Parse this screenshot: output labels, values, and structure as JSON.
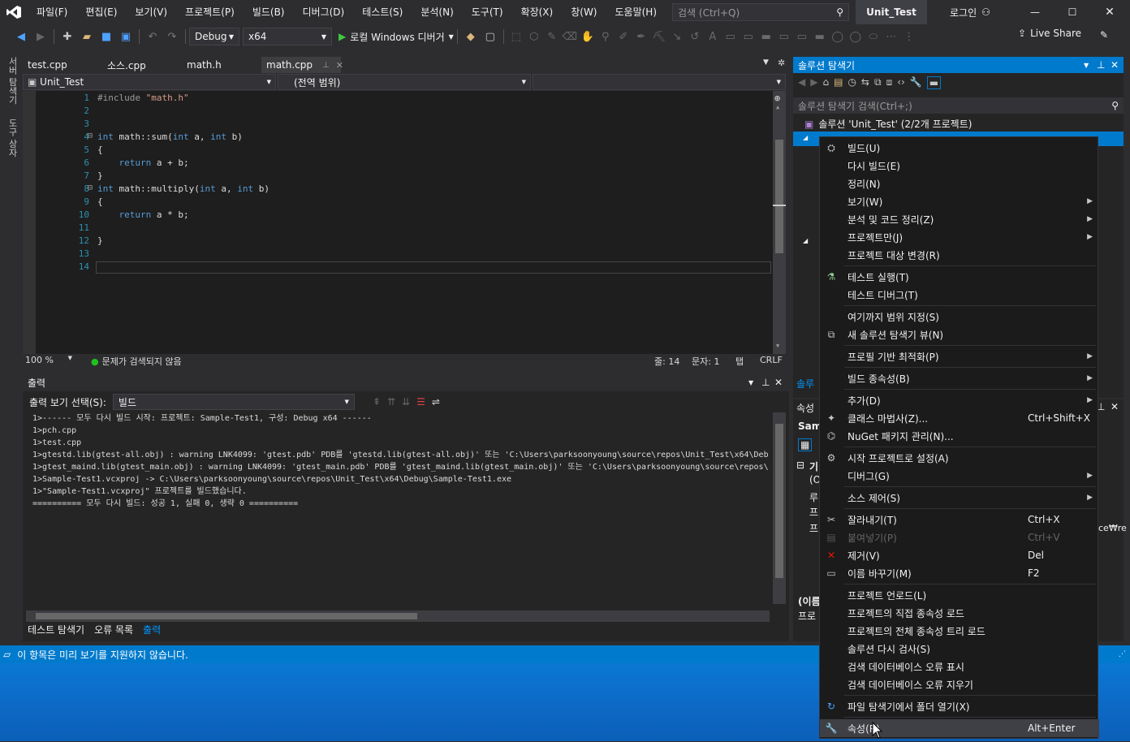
{
  "menubar": {
    "items": [
      "파일(F)",
      "편집(E)",
      "보기(V)",
      "프로젝트(P)",
      "빌드(B)",
      "디버그(D)",
      "테스트(S)",
      "분석(N)",
      "도구(T)",
      "확장(X)",
      "창(W)",
      "도움말(H)"
    ],
    "search_placeholder": "검색 (Ctrl+Q)",
    "solution_name": "Unit_Test",
    "login": "로그인"
  },
  "toolbar": {
    "config": "Debug",
    "platform": "x64",
    "run_label": "로컬 Windows 디버거",
    "live_share": "Live Share"
  },
  "left_strip": {
    "server_explorer": "서버 탐색기",
    "toolbox": "도구 상자"
  },
  "editor_tabs": [
    {
      "label": "test.cpp"
    },
    {
      "label": "소스.cpp"
    },
    {
      "label": "math.h"
    },
    {
      "label": "math.cpp",
      "active": true
    }
  ],
  "navbar": {
    "project": "Unit_Test",
    "scope": "(전역 범위)"
  },
  "code_lines": [
    {
      "n": "1",
      "text": "#include \"math.h\""
    },
    {
      "n": "2",
      "text": ""
    },
    {
      "n": "3",
      "text": ""
    },
    {
      "n": "4",
      "text": "int math::sum(int a, int b)"
    },
    {
      "n": "5",
      "text": "{"
    },
    {
      "n": "6",
      "text": "    return a + b;"
    },
    {
      "n": "7",
      "text": "}"
    },
    {
      "n": "8",
      "text": "int math::multiply(int a, int b)"
    },
    {
      "n": "9",
      "text": "{"
    },
    {
      "n": "10",
      "text": "    return a * b;"
    },
    {
      "n": "11",
      "text": ""
    },
    {
      "n": "12",
      "text": "}"
    },
    {
      "n": "13",
      "text": ""
    },
    {
      "n": "14",
      "text": ""
    }
  ],
  "editor_status": {
    "zoom": "100 %",
    "issues": "문제가 검색되지 않음",
    "line": "줄: 14",
    "col": "문자: 1",
    "tab": "탭",
    "eol": "CRLF"
  },
  "output": {
    "title": "출력",
    "source_label": "출력 보기 선택(S):",
    "source_value": "빌드",
    "lines": [
      "1>------ 모두 다시 빌드 시작: 프로젝트: Sample-Test1, 구성: Debug x64 ------",
      "1>pch.cpp",
      "1>test.cpp",
      "1>gtestd.lib(gtest-all.obj) : warning LNK4099: 'gtest.pdb' PDB를 'gtestd.lib(gtest-all.obj)' 또는 'C:\\Users\\parksoonyoung\\source\\repos\\Unit_Test\\x64\\Deb",
      "1>gtest_maind.lib(gtest_main.obj) : warning LNK4099: 'gtest_main.pdb' PDB를 'gtest_maind.lib(gtest_main.obj)' 또는 'C:\\Users\\parksoonyoung\\source\\repos\\",
      "1>Sample-Test1.vcxproj -> C:\\Users\\parksoonyoung\\source\\repos\\Unit_Test\\x64\\Debug\\Sample-Test1.exe",
      "1>\"Sample-Test1.vcxproj\" 프로젝트를 빌드했습니다.",
      "========== 모두 다시 빌드: 성공 1, 실패 0, 생략 0 =========="
    ]
  },
  "bottom_tabs": [
    "테스트 탐색기",
    "오류 목록",
    "출력"
  ],
  "statusbar": {
    "message": "이 항목은 미리 보기를 지원하지 않습니다."
  },
  "solution_explorer": {
    "title": "솔루션 탐색기",
    "search_placeholder": "솔루션 탐색기 검색(Ctrl+;)",
    "root": "솔루션 'Unit_Test' (2/2개 프로젝트)",
    "lower_tab": "솔루",
    "props_title": "속성",
    "props_sam": "Sam",
    "props_gi": "기",
    "props_o": "(O",
    "props_ru": "루",
    "props_p1": "프",
    "props_p2": "프",
    "props_name": "(이름",
    "props_p3": "프로",
    "props_path_tail": "ce₩re"
  },
  "context_menu": {
    "items": [
      {
        "label": "빌드(U)",
        "icon": "build-icon"
      },
      {
        "label": "다시 빌드(E)"
      },
      {
        "label": "정리(N)"
      },
      {
        "label": "보기(W)",
        "submenu": true
      },
      {
        "label": "분석 및 코드 정리(Z)",
        "submenu": true
      },
      {
        "label": "프로젝트만(J)",
        "submenu": true
      },
      {
        "label": "프로젝트 대상 변경(R)"
      },
      {
        "sep": true
      },
      {
        "label": "테스트 실행(T)",
        "icon": "run-tests-icon"
      },
      {
        "label": "테스트 디버그(T)"
      },
      {
        "sep": true
      },
      {
        "label": "여기까지 범위 지정(S)"
      },
      {
        "label": "새 솔루션 탐색기 뷰(N)",
        "icon": "new-view-icon"
      },
      {
        "sep": true
      },
      {
        "label": "프로필 기반 최적화(P)",
        "submenu": true
      },
      {
        "sep": true
      },
      {
        "label": "빌드 종속성(B)",
        "submenu": true
      },
      {
        "sep": true
      },
      {
        "label": "추가(D)",
        "submenu": true
      },
      {
        "label": "클래스 마법사(Z)...",
        "shortcut": "Ctrl+Shift+X",
        "icon": "class-wizard-icon"
      },
      {
        "label": "NuGet 패키지 관리(N)...",
        "icon": "nuget-icon"
      },
      {
        "sep": true
      },
      {
        "label": "시작 프로젝트로 설정(A)",
        "icon": "gear-icon"
      },
      {
        "label": "디버그(G)",
        "submenu": true
      },
      {
        "sep": true
      },
      {
        "label": "소스 제어(S)",
        "submenu": true
      },
      {
        "sep": true
      },
      {
        "label": "잘라내기(T)",
        "shortcut": "Ctrl+X",
        "icon": "cut-icon"
      },
      {
        "label": "붙여넣기(P)",
        "shortcut": "Ctrl+V",
        "disabled": true,
        "icon": "paste-icon"
      },
      {
        "label": "제거(V)",
        "shortcut": "Del",
        "icon": "remove-icon"
      },
      {
        "label": "이름 바꾸기(M)",
        "shortcut": "F2",
        "icon": "rename-icon"
      },
      {
        "sep": true
      },
      {
        "label": "프로젝트 언로드(L)"
      },
      {
        "label": "프로젝트의 직접 종속성 로드"
      },
      {
        "label": "프로젝트의 전체 종속성 트리 로드"
      },
      {
        "label": "솔루션 다시 검사(S)"
      },
      {
        "label": "검색 데이터베이스 오류 표시"
      },
      {
        "label": "검색 데이터베이스 오류 지우기"
      },
      {
        "sep": true
      },
      {
        "label": "파일 탐색기에서 폴더 열기(X)",
        "icon": "open-folder-icon"
      },
      {
        "sep": true
      },
      {
        "label": "속성(R)",
        "shortcut": "Alt+Enter",
        "icon": "wrench-icon",
        "highlight": true
      }
    ]
  },
  "colors": {
    "accent": "#007acc",
    "bg": "#2d2d30",
    "editor": "#1e1e1e",
    "keyword": "#569cd6",
    "string": "#d69d85"
  }
}
